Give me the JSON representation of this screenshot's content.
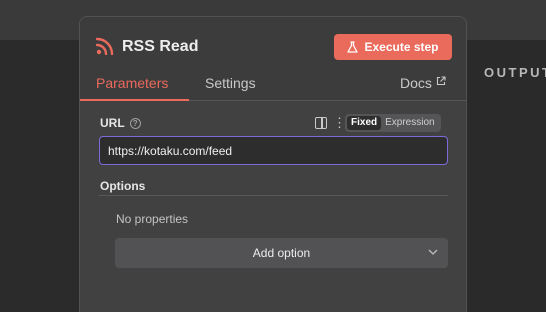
{
  "node": {
    "title": "RSS Read",
    "execute_label": "Execute step"
  },
  "tabs": [
    {
      "label": "Parameters",
      "active": true
    },
    {
      "label": "Settings",
      "active": false
    },
    {
      "label": "Docs",
      "active": false
    }
  ],
  "url_field": {
    "label": "URL",
    "value": "https://kotaku.com/feed",
    "mode_fixed": "Fixed",
    "mode_expression": "Expression",
    "active_mode": "Fixed"
  },
  "options": {
    "label": "Options",
    "empty_text": "No properties",
    "add_label": "Add option"
  },
  "output_label": "OUTPUT",
  "colors": {
    "accent": "#ea6a5c",
    "panel": "#414142",
    "input_border": "#7c6bd8"
  },
  "icons": [
    "rss-icon",
    "flask-icon",
    "external-link-icon",
    "help-icon",
    "panel-toggle-icon",
    "kebab-menu-icon",
    "chevron-down-icon"
  ]
}
